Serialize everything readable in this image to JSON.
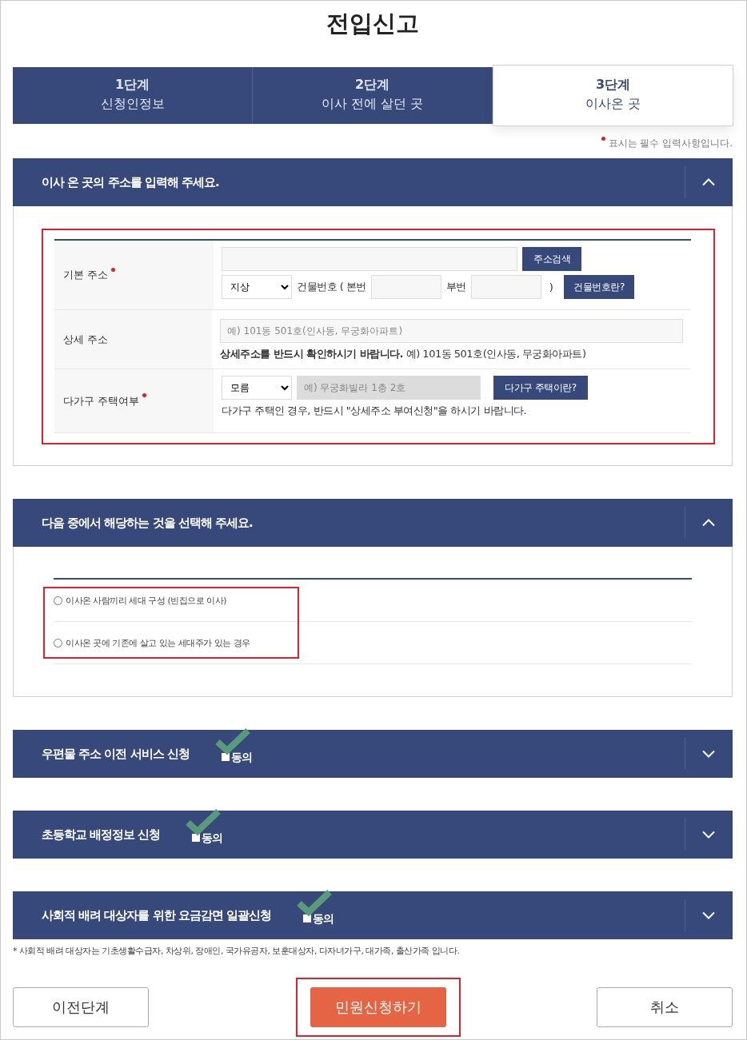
{
  "title": "전입신고",
  "steps": [
    {
      "number": "1단계",
      "label": "신청인정보",
      "selected": false
    },
    {
      "number": "2단계",
      "label": "이사 전에 살던 곳",
      "selected": false
    },
    {
      "number": "3단계",
      "label": "이사온 곳",
      "selected": true
    }
  ],
  "required_note": "표시는 필수 입력사항입니다.",
  "address_section": {
    "title": "이사 온 곳의 주소를 입력해 주세요.",
    "expanded": true,
    "highlighted": true,
    "basic": {
      "label": "기본 주소",
      "required": true,
      "search_button": "주소검색",
      "floor_select": "지상",
      "building_label": "건물번호 ( 본번",
      "sub_label": "부번",
      "close_paren": ")",
      "help_button": "건물번호란?"
    },
    "detail": {
      "label": "상세 주소",
      "required": false,
      "placeholder": "예) 101동 501호(인사동, 무궁화아파트)",
      "note": "**상세주소를 반드시 확인하시기 바랍니다.** 예) 101동 501호(인사동, 무궁화아파트)"
    },
    "multi": {
      "label": "다가구 주택여부",
      "required": true,
      "select": "모름",
      "placeholder": "예) 무궁화빌라 1층 2호",
      "disabled": true,
      "help_button": "다가구 주택이란?",
      "note": "다가구 주택인 경우, 반드시 \"상세주소 부여신청\"을 하시기 바랍니다."
    }
  },
  "choice_section": {
    "title": "다음 중에서 해당하는 것을 선택해 주세요.",
    "expanded": true,
    "highlighted": true,
    "options": [
      {
        "label": "이사온 사람끼리 세대 구성 (빈집으로 이사)",
        "selected": false
      },
      {
        "label": "이사온 곳에 기존에 살고 있는 세대주가 있는 경우",
        "selected": false
      }
    ]
  },
  "agreements": [
    {
      "title": "우편물 주소 이전 서비스 신청",
      "expanded": false,
      "checked": true,
      "agree_label": "동의"
    },
    {
      "title": "초등학교 배정정보 신청",
      "expanded": false,
      "checked": true,
      "agree_label": "동의"
    },
    {
      "title": "사회적 배려 대상자를 위한 요금감면 일괄신청",
      "expanded": false,
      "checked": true,
      "agree_label": "동의"
    }
  ],
  "footnote": "* 사회적 배려 대상자는 기초생활수급자, 차상위, 장애인, 국가유공자, 보훈대상자, 다자녀가구, 대가족, 출산가족 입니다.",
  "buttons": {
    "previous": "이전단계",
    "submit": "민원신청하기",
    "submit_highlighted": true,
    "cancel": "취소"
  }
}
